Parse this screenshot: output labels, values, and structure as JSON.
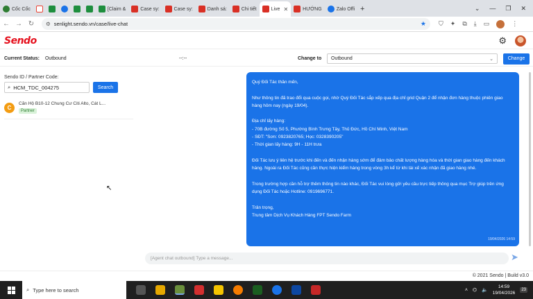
{
  "browser": {
    "tabs": [
      {
        "label": "Cốc Cốc",
        "icon": "coccoc-icon"
      },
      {
        "label": "",
        "icon": "gmail-icon"
      },
      {
        "label": "",
        "icon": "sheets-icon"
      },
      {
        "label": "",
        "icon": "messenger-icon"
      },
      {
        "label": "",
        "icon": "sheets-icon"
      },
      {
        "label": "",
        "icon": "sheets-icon"
      },
      {
        "label": "[Claim &",
        "icon": "sheets-icon"
      },
      {
        "label": "Case sy:",
        "icon": "sendo-icon"
      },
      {
        "label": "Case sy:",
        "icon": "sendo-icon"
      },
      {
        "label": "Danh sá:",
        "icon": "sendo-icon"
      },
      {
        "label": "Chi tiết",
        "icon": "sendo-icon"
      },
      {
        "label": "Live",
        "icon": "sendo-icon",
        "active": true
      },
      {
        "label": "HƯỚNG",
        "icon": "sendo-icon"
      },
      {
        "label": "Zalo Offi",
        "icon": "zalo-icon"
      }
    ],
    "url": "senlight.sendo.vn/case/live-chat"
  },
  "app": {
    "logo": "Sendo",
    "brand_color": "#e5101d",
    "accent_color": "#1a73e8"
  },
  "status": {
    "current_label": "Current Status:",
    "current_value": "Outbound",
    "separator": "--:--",
    "change_label": "Change to",
    "select_value": "Outbound",
    "change_button": "Change"
  },
  "sidebar": {
    "search_label": "Sendo ID / Partner Code:",
    "search_value": "HCM_TDC_004275",
    "search_button": "Search",
    "conversations": [
      {
        "initial": "C",
        "title": "Căn Hộ B10-12 Chung Cư Citi Alto, Cát L...",
        "badge": "Partner"
      }
    ]
  },
  "chat": {
    "message": "Quý Đối Tác thân mến,\n\nNhư thông tin đã trao đổi qua cuộc gọi, nhờ Quý Đối Tác sắp xếp qua địa chỉ grid Quận 2 để nhận đơn hàng thuộc phiên giao hàng hôm nay (ngày 19/04).\n\nĐịa chỉ lấy hàng:\n- 70B đường Số 5, Phường Bình Trưng Tây, Thủ Đức, Hồ Chí Minh, Việt Nam\n- SĐT: \"Sơn: 0923820765; Học: 0328390205\"\n- Thời gian lấy hàng: 9H - 11H trưa\n\nĐối Tác lưu ý liên hệ trước khi đến và đến nhận hàng sớm để đảm bảo chất lượng hàng hóa và thời gian giao hàng đến khách hàng. Ngoài ra Đối Tác cũng cần thực hiện kiểm hàng trong vòng 3h kể từ khi tài xế xác nhận đã giao hàng nhé.\n\nTrong trường hợp cần hỗ trợ thêm thông tin nào khác, Đối Tác vui lòng gửi yêu cầu trực tiếp thông qua mục Trợ giúp trên ứng dụng Đối Tác hoặc  Hotline: 0919696771.\n\nTrân trọng,\nTrung tâm Dịch Vụ Khách Hàng FPT Sendo Farm",
    "timestamp": "19/04/2026 14:59",
    "composer_placeholder": "[Agent chat outbound] Type a message..."
  },
  "footer": {
    "text": "© 2021 Sendo | Build v3.0"
  },
  "taskbar": {
    "search_placeholder": "Type here to search",
    "time": "14:59",
    "date": "19/04/2026",
    "notifications": "23"
  }
}
